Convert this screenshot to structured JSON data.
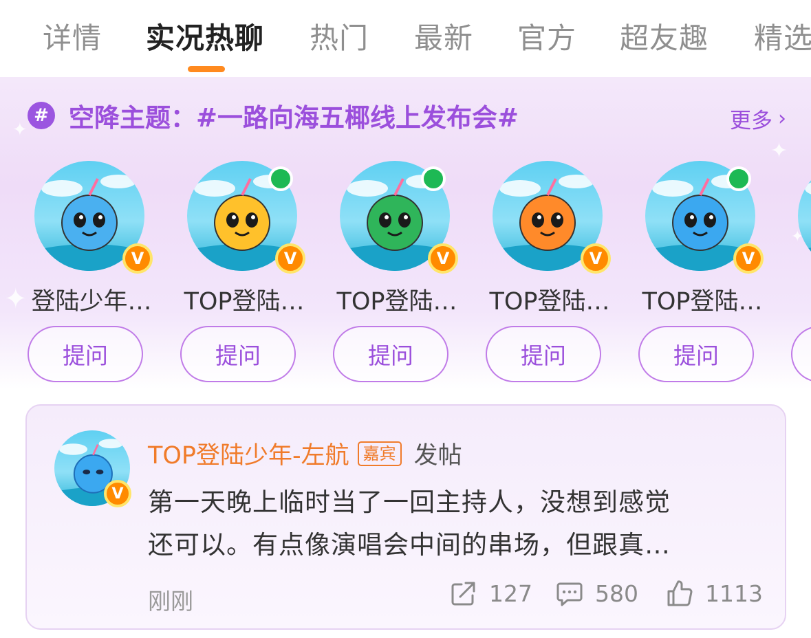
{
  "tabs": [
    {
      "label": "详情"
    },
    {
      "label": "实况热聊"
    },
    {
      "label": "热门"
    },
    {
      "label": "最新"
    },
    {
      "label": "官方"
    },
    {
      "label": "超友趣"
    },
    {
      "label": "精选"
    }
  ],
  "active_tab": "实况热聊",
  "topic": {
    "hash_symbol": "#",
    "title": "空降主题：#一路向海五椰线上发布会#",
    "more_label": "更多",
    "more_icon": "chevron-right-icon"
  },
  "guests": [
    {
      "name": "登陆少年…",
      "ask_label": "提问",
      "online": false,
      "verified": "V",
      "color": "#4ab0f0"
    },
    {
      "name": "TOP登陆…",
      "ask_label": "提问",
      "online": true,
      "verified": "V",
      "color": "#ffc12b"
    },
    {
      "name": "TOP登陆…",
      "ask_label": "提问",
      "online": true,
      "verified": "V",
      "color": "#2fb55a"
    },
    {
      "name": "TOP登陆…",
      "ask_label": "提问",
      "online": false,
      "verified": "V",
      "color": "#ff8a2a"
    },
    {
      "name": "TOP登陆…",
      "ask_label": "提问",
      "online": true,
      "verified": "V",
      "color": "#3ba8f0"
    },
    {
      "name": "TO",
      "ask_label": "",
      "online": false,
      "verified": "",
      "color": "#3ba8f0"
    }
  ],
  "post": {
    "author": "TOP登陆少年-左航",
    "author_tag": "嘉宾",
    "action": "发帖",
    "verified": "V",
    "content_lines": [
      "第一天晚上临时当了一回主持人，没想到感觉",
      "还可以。有点像演唱会中间的串场，但跟真…"
    ],
    "time": "刚刚",
    "shares": "127",
    "comments": "580",
    "likes": "1113"
  },
  "colors": {
    "accent_orange": "#ff8a1f",
    "topic_purple": "#9b4fdc",
    "online_green": "#1db954"
  }
}
